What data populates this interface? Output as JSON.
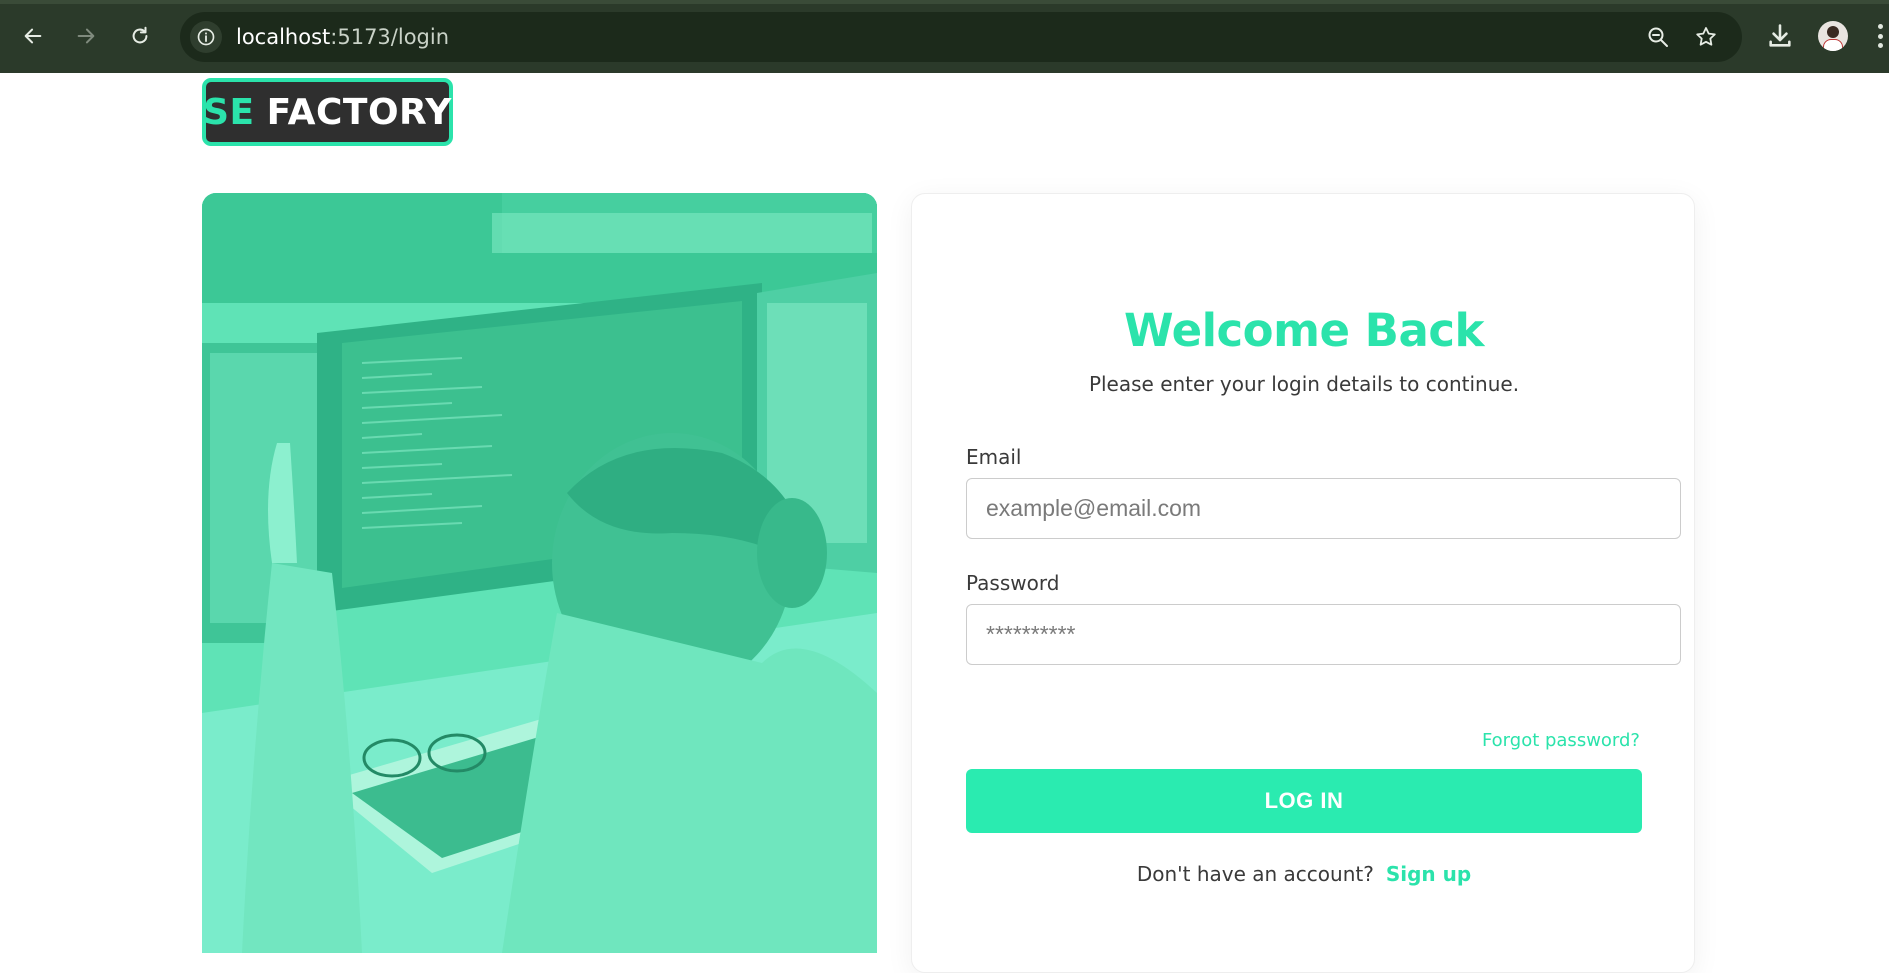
{
  "browser": {
    "url_host": "localhost",
    "url_path": ":5173/login",
    "icons": [
      "back-icon",
      "forward-icon",
      "reload-icon",
      "site-info-icon",
      "zoom-icon",
      "bookmark-star-icon",
      "download-icon",
      "profile-avatar",
      "menu-icon"
    ]
  },
  "brand": {
    "logo_se": "SE",
    "logo_factory": "FACTORY",
    "accent_color": "#2be3ab"
  },
  "login": {
    "title": "Welcome Back",
    "subtitle": "Please enter your login details to continue.",
    "email_label": "Email",
    "email_placeholder": "example@email.com",
    "password_label": "Password",
    "password_placeholder": "**********",
    "forgot_label": "Forgot password?",
    "submit_label": "LOG IN",
    "signup_prompt": "Don't have an account?",
    "signup_link": "Sign up"
  }
}
